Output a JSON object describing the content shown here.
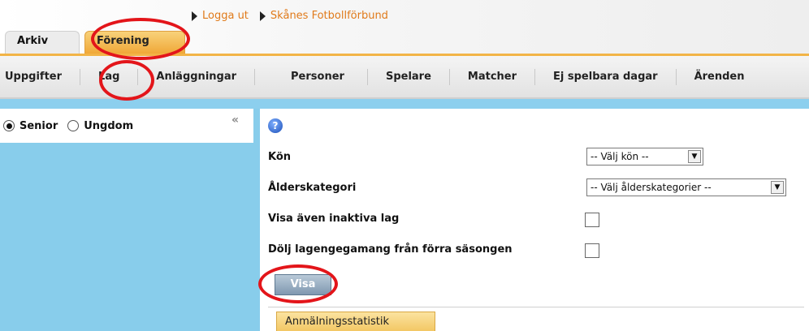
{
  "header": {
    "links": [
      {
        "label": "Logga ut"
      },
      {
        "label": "Skånes Fotbollförbund"
      }
    ],
    "tabs": [
      {
        "label": "Arkiv"
      },
      {
        "label": "Förening"
      }
    ]
  },
  "nav": {
    "items": [
      "Uppgifter",
      "Lag",
      "Anläggningar",
      "Personer",
      "Spelare",
      "Matcher",
      "Ej spelbara dagar",
      "Ärenden"
    ]
  },
  "left_panel": {
    "radios": [
      {
        "label": "Senior",
        "checked": true
      },
      {
        "label": "Ungdom",
        "checked": false
      }
    ],
    "collapse_glyph": "«"
  },
  "form": {
    "help_glyph": "?",
    "fields": {
      "kon": {
        "label": "Kön",
        "value": "-- Välj kön --"
      },
      "alderskategori": {
        "label": "Ålderskategori",
        "value": "-- Välj ålderskategorier --"
      },
      "inaktiva": {
        "label": "Visa även inaktiva lag",
        "checked": false
      },
      "dolj": {
        "label": "Dölj lagengegamang från förra säsongen",
        "checked": false
      }
    },
    "submit_label": "Visa",
    "stat_tab_label": "Anmälningsstatistik"
  },
  "colors": {
    "accent_orange": "#f0a838",
    "panel_blue": "#88cdeb",
    "annotation_red": "#e3151a",
    "link_orange": "#e07a1a"
  }
}
